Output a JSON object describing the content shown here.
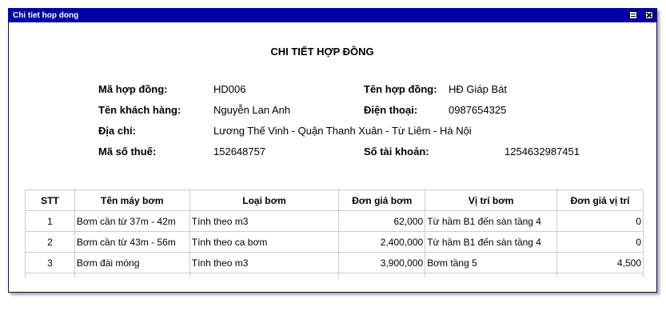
{
  "window": {
    "title": "Chi tiet hop dong"
  },
  "heading": "CHI TIẾT HỢP ĐỒNG",
  "fields": {
    "contract_code_label": "Mã hợp đồng:",
    "contract_code_value": "HD006",
    "contract_name_label": "Tên hợp đồng:",
    "contract_name_value": "HĐ Giáp Bát",
    "customer_label": "Tên khách hàng:",
    "customer_value": "Nguyễn Lan Anh",
    "phone_label": "Điện thoại:",
    "phone_value": "0987654325",
    "address_label": "Địa chỉ:",
    "address_value": "Lương Thế Vinh - Quận Thanh Xuân - Từ Liêm - Hà Nội",
    "tax_label": "Mã số thuế:",
    "tax_value": "152648757",
    "account_label": "Số tài khoản:",
    "account_value": "1254632987451"
  },
  "table": {
    "headers": [
      "STT",
      "Tên máy bơm",
      "Loại bơm",
      "Đơn giá bơm",
      "Vị trí bơm",
      "Đơn giá vị trí"
    ],
    "rows": [
      [
        "1",
        "Bơm cần từ 37m - 42m",
        "Tính theo m3",
        "62,000",
        "Từ hầm B1 đến sàn tầng 4",
        "0"
      ],
      [
        "2",
        "Bơm cần từ 43m - 56m",
        "Tính theo ca bơm",
        "2,400,000",
        "Từ hầm B1 đến sàn tầng 4",
        "0"
      ],
      [
        "3",
        "Bơm đài móng",
        "Tính theo m3",
        "3,900,000",
        "Bơm tầng 5",
        "4,500"
      ]
    ]
  }
}
